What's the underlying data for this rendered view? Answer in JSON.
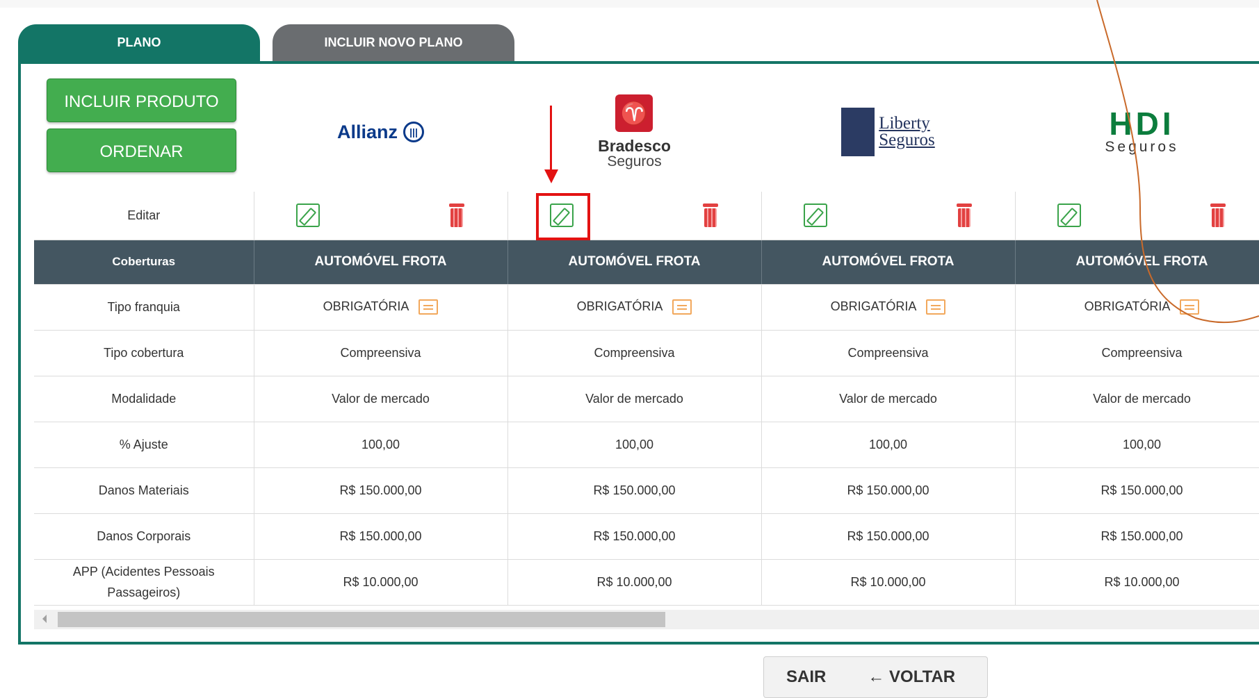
{
  "tabs": [
    {
      "label": "PLANO",
      "active": true
    },
    {
      "label": "INCLUIR NOVO PLANO",
      "active": false
    }
  ],
  "actions": {
    "include_product": "INCLUIR PRODUTO",
    "order": "ORDENAR"
  },
  "insurers": [
    {
      "name": "Allianz"
    },
    {
      "name": "Bradesco",
      "sub": "Seguros"
    },
    {
      "name_line1": "Liberty",
      "name_line2": "Seguros"
    },
    {
      "name": "HDI",
      "sub": "Seguros"
    }
  ],
  "table": {
    "edit_label": "Editar",
    "header_label": "Coberturas",
    "columns": [
      "AUTOMÓVEL FROTA",
      "AUTOMÓVEL FROTA",
      "AUTOMÓVEL FROTA",
      "AUTOMÓVEL FROTA"
    ],
    "rows": [
      {
        "label": "Tipo franquia",
        "values": [
          "OBRIGATÓRIA",
          "OBRIGATÓRIA",
          "OBRIGATÓRIA",
          "OBRIGATÓRIA"
        ]
      },
      {
        "label": "Tipo cobertura",
        "values": [
          "Compreensiva",
          "Compreensiva",
          "Compreensiva",
          "Compreensiva"
        ]
      },
      {
        "label": "Modalidade",
        "values": [
          "Valor de mercado",
          "Valor de mercado",
          "Valor de mercado",
          "Valor de mercado"
        ]
      },
      {
        "label": "% Ajuste",
        "values": [
          "100,00",
          "100,00",
          "100,00",
          "100,00"
        ]
      },
      {
        "label": "Danos Materiais",
        "values": [
          "R$ 150.000,00",
          "R$ 150.000,00",
          "R$ 150.000,00",
          "R$ 150.000,00"
        ]
      },
      {
        "label": "Danos Corporais",
        "values": [
          "R$ 150.000,00",
          "R$ 150.000,00",
          "R$ 150.000,00",
          "R$ 150.000,00"
        ]
      },
      {
        "label": "APP (Acidentes Pessoais Passageiros)",
        "values": [
          "R$ 10.000,00",
          "R$ 10.000,00",
          "R$ 10.000,00",
          "R$ 10.000,00"
        ]
      }
    ]
  },
  "footer": {
    "exit": "SAIR",
    "back": "← VOLTAR"
  },
  "colors": {
    "primary": "#137566",
    "button_green": "#43ad4f",
    "header_dark": "#445661",
    "highlight_red": "#e31212"
  }
}
